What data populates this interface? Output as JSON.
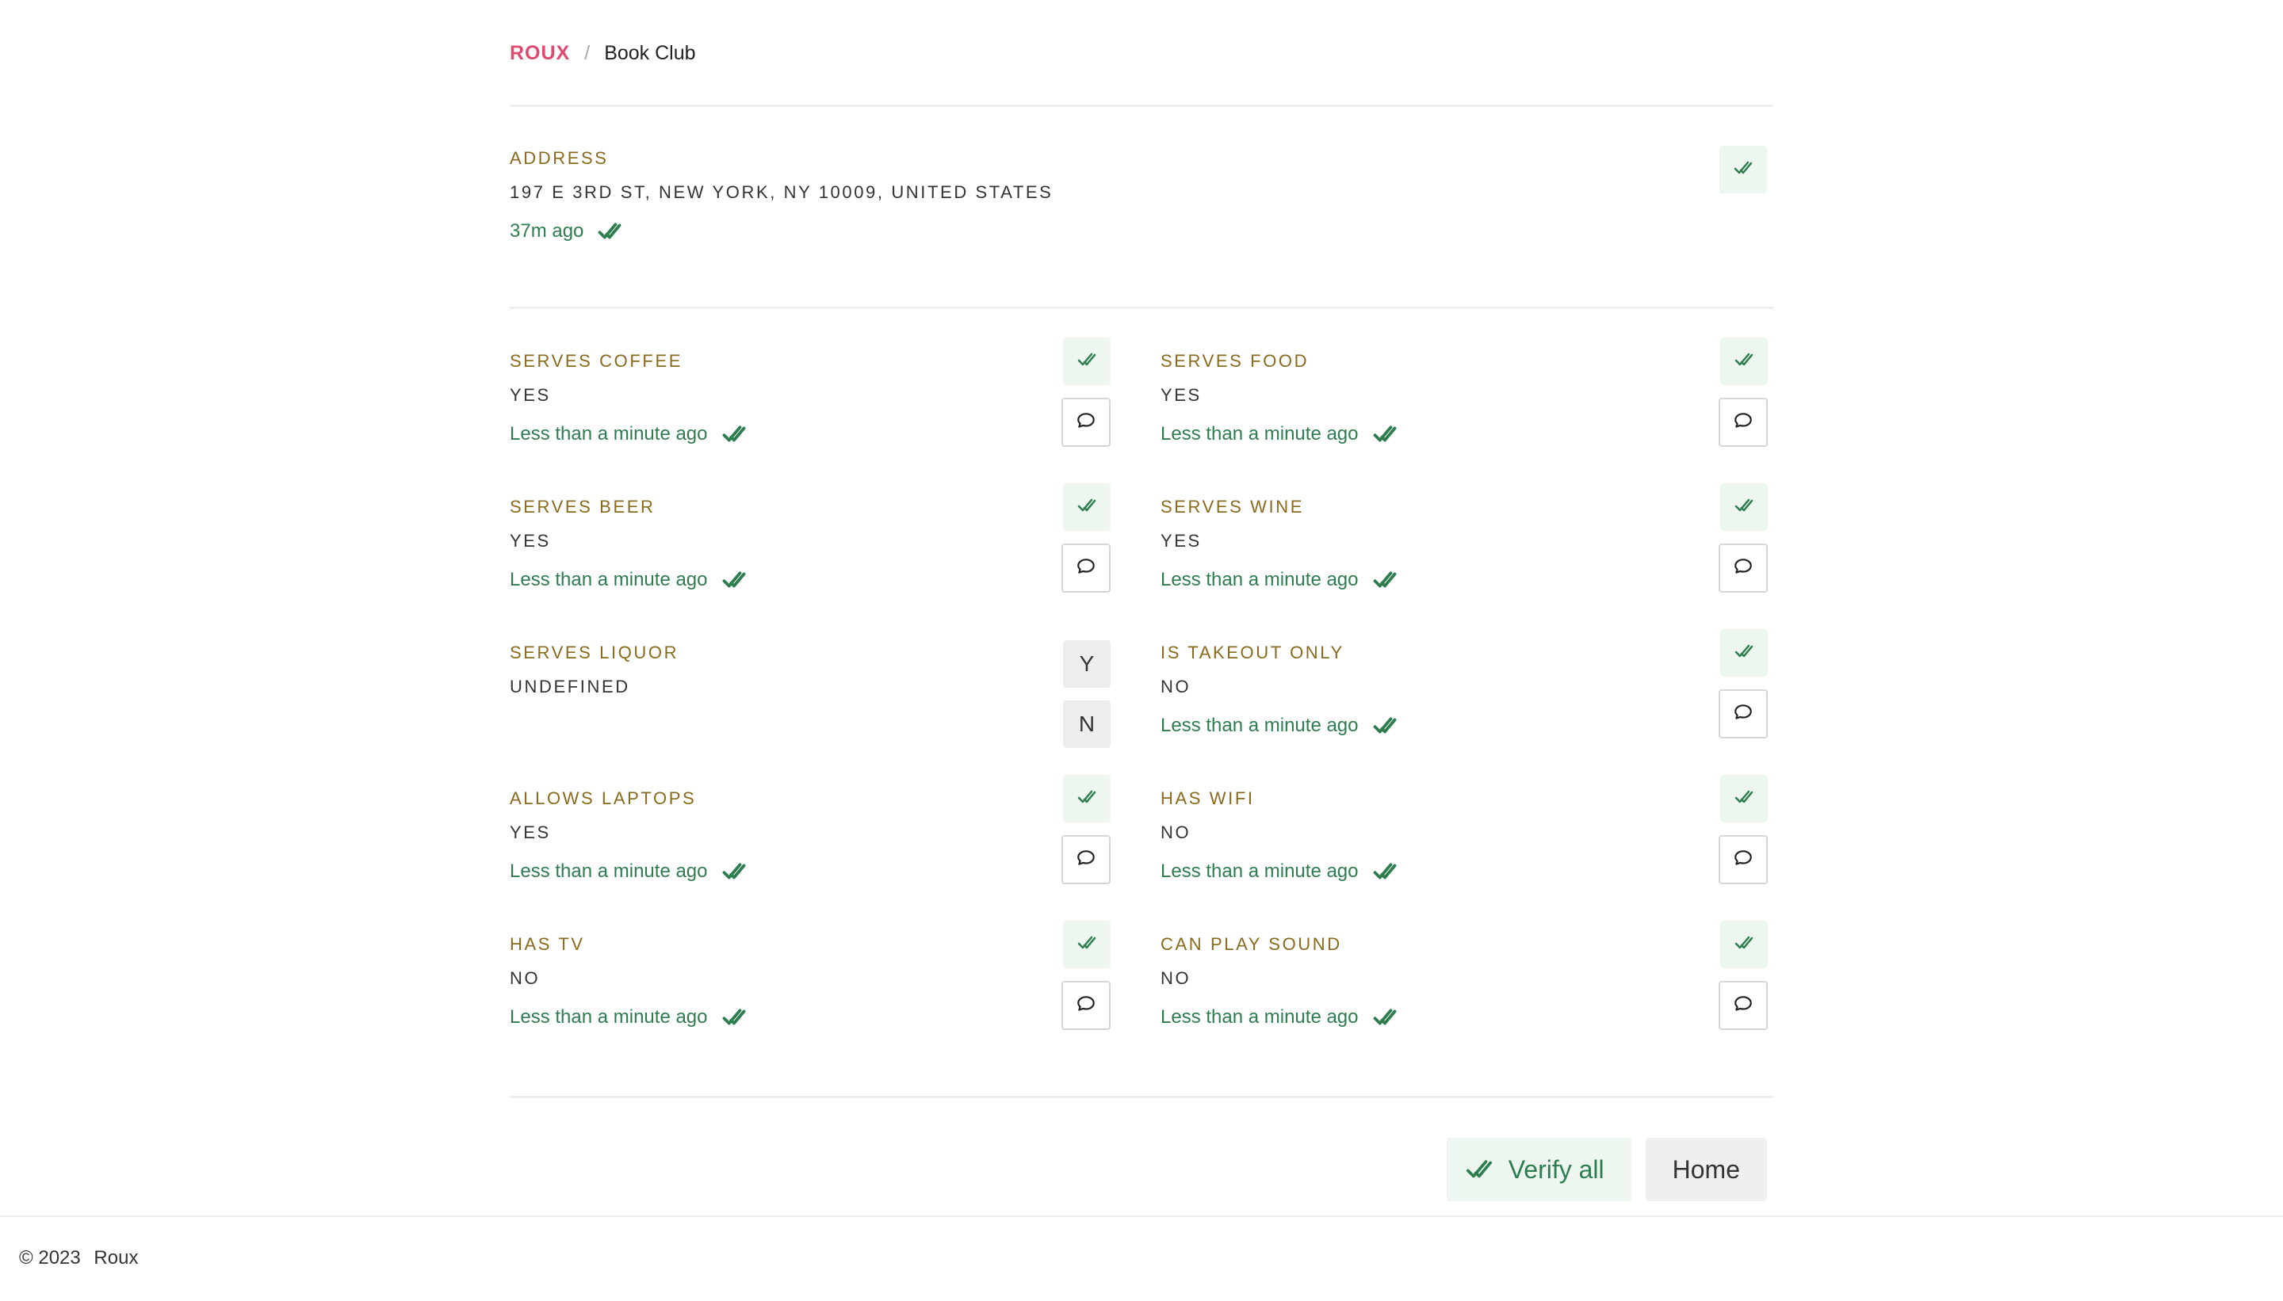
{
  "breadcrumb": {
    "brand": "ROUX",
    "separator": "/",
    "page": "Book Club"
  },
  "address": {
    "label": "ADDRESS",
    "value": "197 E 3RD ST, NEW YORK, NY 10009, UNITED STATES",
    "meta": "37m ago"
  },
  "fields": [
    {
      "label": "SERVES COFFEE",
      "value": "YES",
      "meta": "Less than a minute ago"
    },
    {
      "label": "SERVES FOOD",
      "value": "YES",
      "meta": "Less than a minute ago"
    },
    {
      "label": "SERVES BEER",
      "value": "YES",
      "meta": "Less than a minute ago"
    },
    {
      "label": "SERVES WINE",
      "value": "YES",
      "meta": "Less than a minute ago"
    },
    {
      "label": "SERVES LIQUOR",
      "value": "UNDEFINED",
      "yes_label": "Y",
      "no_label": "N"
    },
    {
      "label": "IS TAKEOUT ONLY",
      "value": "NO",
      "meta": "Less than a minute ago"
    },
    {
      "label": "ALLOWS LAPTOPS",
      "value": "YES",
      "meta": "Less than a minute ago"
    },
    {
      "label": "HAS WIFI",
      "value": "NO",
      "meta": "Less than a minute ago"
    },
    {
      "label": "HAS TV",
      "value": "NO",
      "meta": "Less than a minute ago"
    },
    {
      "label": "CAN PLAY SOUND",
      "value": "NO",
      "meta": "Less than a minute ago"
    }
  ],
  "actions": {
    "verify_all": "Verify all",
    "home": "Home"
  },
  "footer": {
    "copyright": "© 2023",
    "brand": "Roux"
  },
  "colors": {
    "brand": "#e04a6e",
    "label": "#8a6a1c",
    "verified": "#2e7d4f",
    "verify_bg": "#edf7f0"
  },
  "icons": {
    "verify": "double-check-icon",
    "comment": "speech-bubble-icon"
  }
}
